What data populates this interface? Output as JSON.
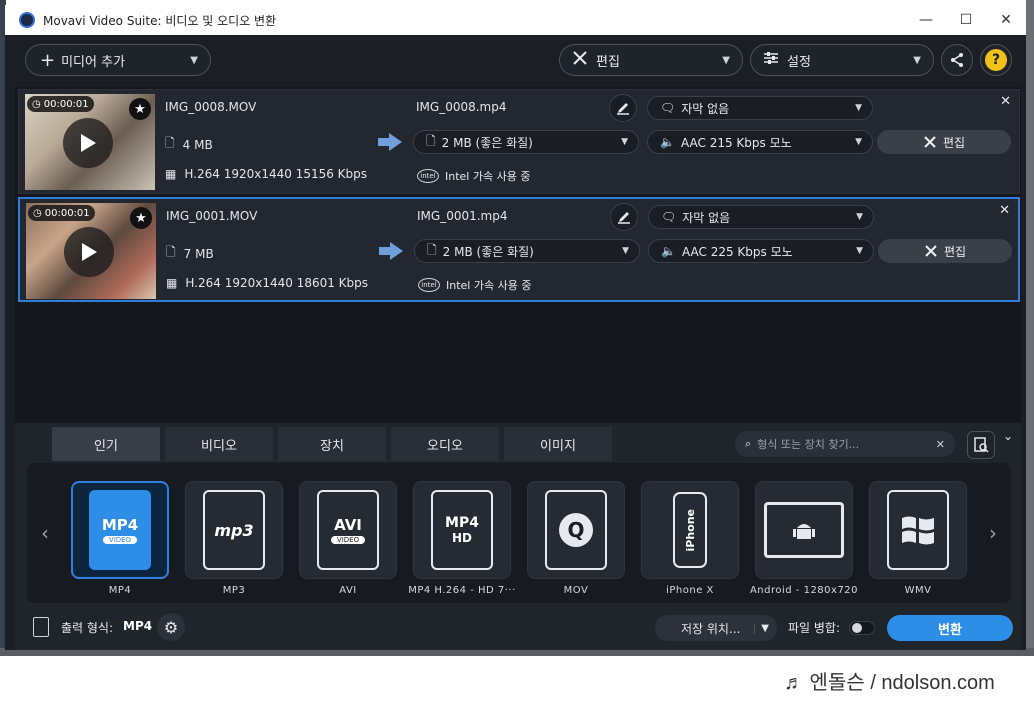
{
  "window": {
    "title": "Movavi Video Suite: 비디오 및 오디오 변환"
  },
  "toolbar": {
    "add_media_label": "미디어 추가",
    "edit_label": "편집",
    "settings_label": "설정"
  },
  "files": [
    {
      "duration": "00:00:01",
      "source_name": "IMG_0008.MOV",
      "source_size": "4 MB",
      "source_codec": "H.264 1920x1440 15156 Kbps",
      "output_name": "IMG_0008.mp4",
      "output_size": "2 MB (좋은 화질)",
      "subtitle": "자막 없음",
      "audio": "AAC 215 Kbps 모노",
      "edit_label": "편집",
      "accel": "Intel 가속 사용 중"
    },
    {
      "duration": "00:00:01",
      "source_name": "IMG_0001.MOV",
      "source_size": "7 MB",
      "source_codec": "H.264 1920x1440 18601 Kbps",
      "output_name": "IMG_0001.mp4",
      "output_size": "2 MB (좋은 화질)",
      "subtitle": "자막 없음",
      "audio": "AAC 225 Kbps 모노",
      "edit_label": "편집",
      "accel": "Intel 가속 사용 중"
    }
  ],
  "format_tabs": [
    "인기",
    "비디오",
    "장치",
    "오디오",
    "이미지"
  ],
  "format_search_placeholder": "형식 또는 장치 찾기...",
  "formats": [
    {
      "label": "MP4",
      "icon_text": "MP4",
      "sub": "VIDEO"
    },
    {
      "label": "MP3",
      "icon_text": "mp3",
      "sub": ""
    },
    {
      "label": "AVI",
      "icon_text": "AVI",
      "sub": "VIDEO"
    },
    {
      "label": "MP4 H.264 - HD 7···",
      "icon_text": "MP4",
      "sub": "HD"
    },
    {
      "label": "MOV",
      "icon_text": "Q",
      "sub": ""
    },
    {
      "label": "iPhone X",
      "icon_text": "iPhone",
      "sub": ""
    },
    {
      "label": "Android - 1280x720",
      "icon_text": "android",
      "sub": ""
    },
    {
      "label": "WMV",
      "icon_text": "windows",
      "sub": ""
    }
  ],
  "footer": {
    "output_format_label": "출력 형식:",
    "output_format_value": "MP4",
    "save_location_label": "저장 위치...",
    "merge_label": "파일 병합:",
    "convert_label": "변환"
  },
  "watermark": "♬ 엔돌슨 / ndolson.com",
  "colors": {
    "accent": "#2d8ee8",
    "selected_border": "#2f7fd8",
    "window_bg": "#1b1e24"
  }
}
